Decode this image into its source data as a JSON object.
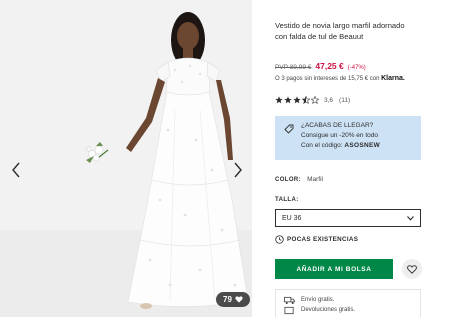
{
  "product": {
    "title": "Vestido de novia largo marfil adornado con falda de tul de Beauut",
    "old_price": "PVP 89,99 €",
    "new_price": "47,25 €",
    "discount": "(-47%)",
    "klarna_text": "O 3 pagos sin intereses de 15,75 € con",
    "klarna_brand": "Klarna.",
    "rating_stars": 3.5,
    "rating_score": "3,6",
    "rating_count": "(11)"
  },
  "promo": {
    "line1": "¿ACABAS DE LLEGAR?",
    "line2": "Consigue un -20% en todo",
    "line3_prefix": "Con el código:",
    "code": "ASOSNEW"
  },
  "color": {
    "label": "COLOR:",
    "value": "Marfil"
  },
  "size": {
    "label": "TALLA:",
    "selected": "EU 36"
  },
  "stock": {
    "text": "POCAS EXISTENCIAS"
  },
  "actions": {
    "add_to_bag": "AÑADIR A MI BOLSA"
  },
  "gallery": {
    "saves_count": "79"
  },
  "delivery": {
    "items": [
      {
        "icon": "truck-icon",
        "text": "Envío gratis."
      },
      {
        "icon": "return-icon",
        "text": "Devoluciones gratis."
      }
    ]
  },
  "colors": {
    "price_red": "#d01345",
    "add_button_green": "#018849",
    "promo_blue": "#cde2f5"
  }
}
